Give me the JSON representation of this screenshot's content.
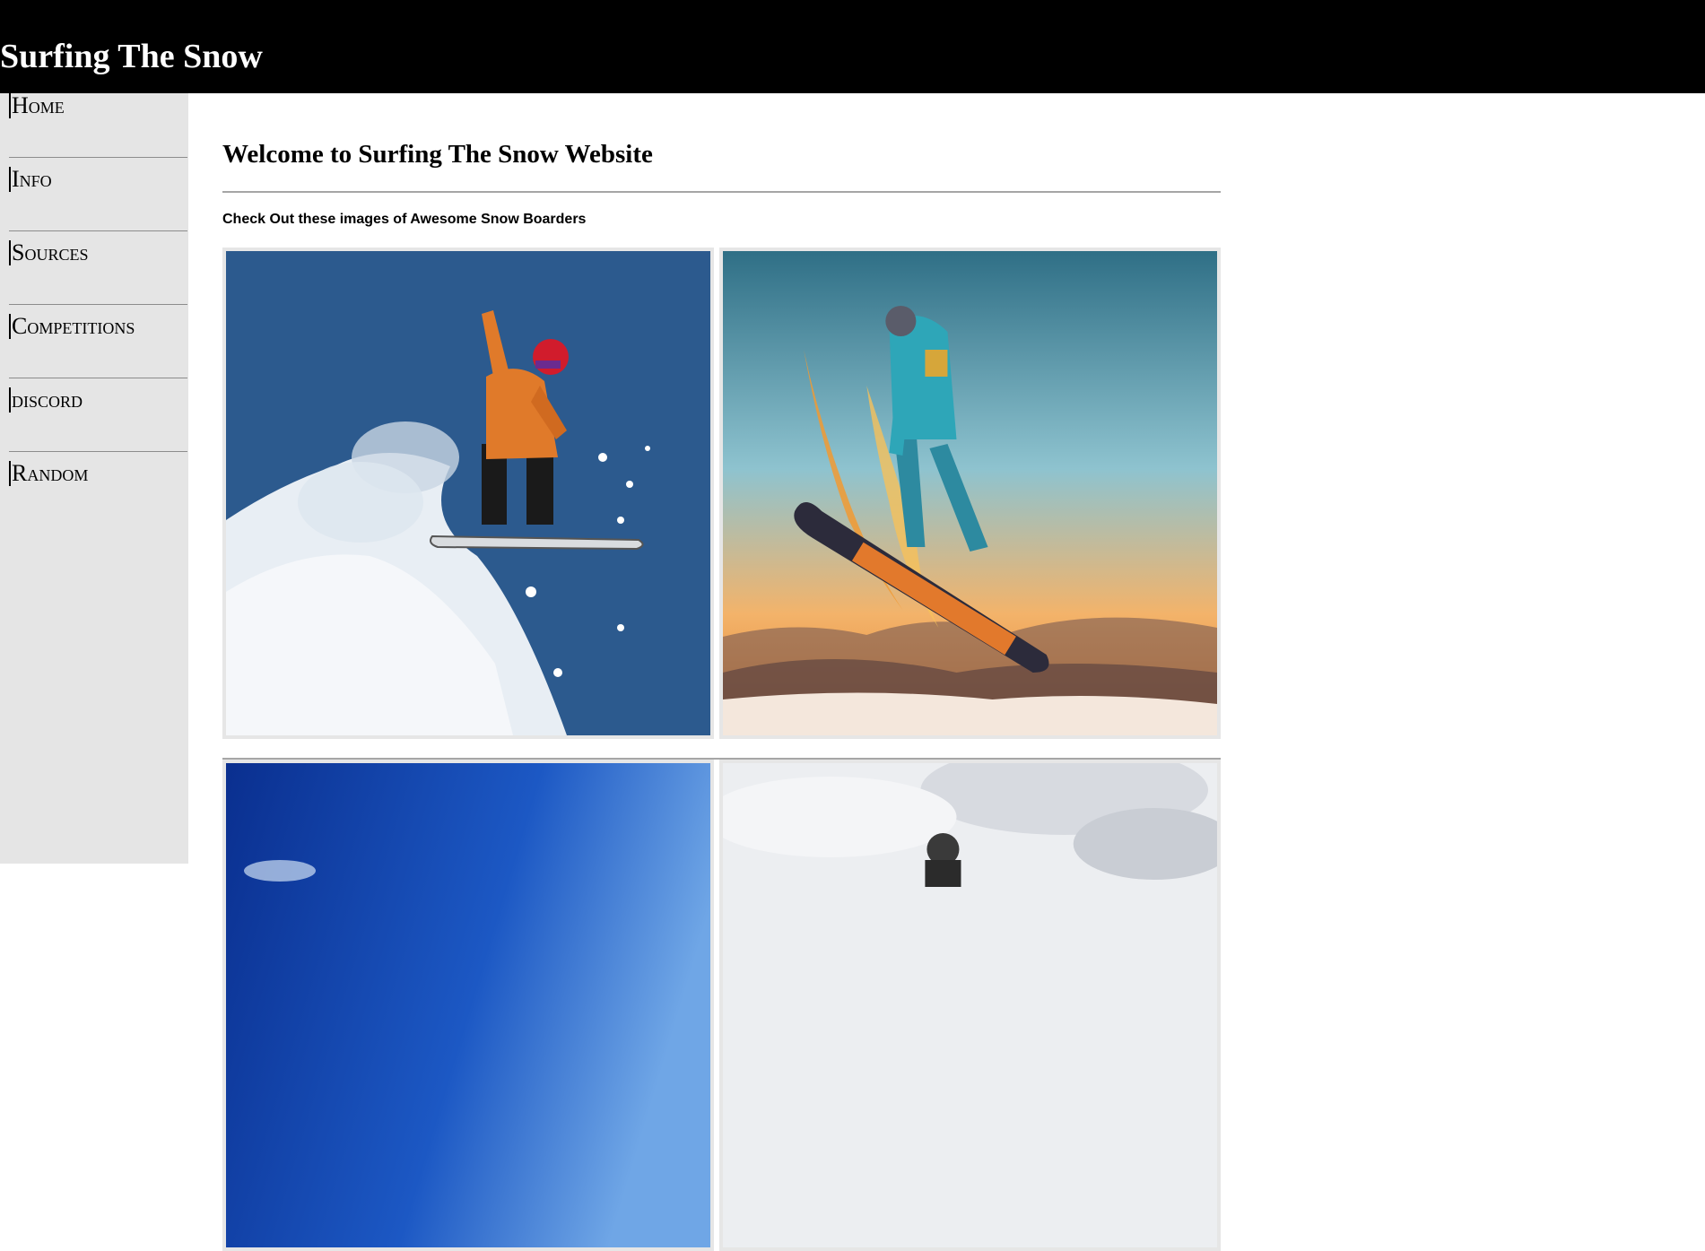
{
  "header": {
    "title": "Surfing The Snow",
    "background": "#000000",
    "title_color": "#ffffff"
  },
  "sidebar": {
    "background": "#e5e5e5",
    "items": [
      {
        "label": "Home"
      },
      {
        "label": "Info"
      },
      {
        "label": "Sources"
      },
      {
        "label": "Competitions"
      },
      {
        "label": "discord"
      },
      {
        "label": "Random"
      }
    ]
  },
  "main": {
    "heading": "Welcome to Surfing The Snow Website",
    "subheading": "Check Out these images of Awesome Snow Boarders",
    "images": [
      {
        "icon": "snowboarder-photo-orange-jacket-blue-sky"
      },
      {
        "icon": "snowboarder-photo-sunset-jump"
      },
      {
        "icon": "snowboarder-photo-deep-blue-sky"
      },
      {
        "icon": "snowboarder-photo-cloudy-sky"
      }
    ]
  }
}
